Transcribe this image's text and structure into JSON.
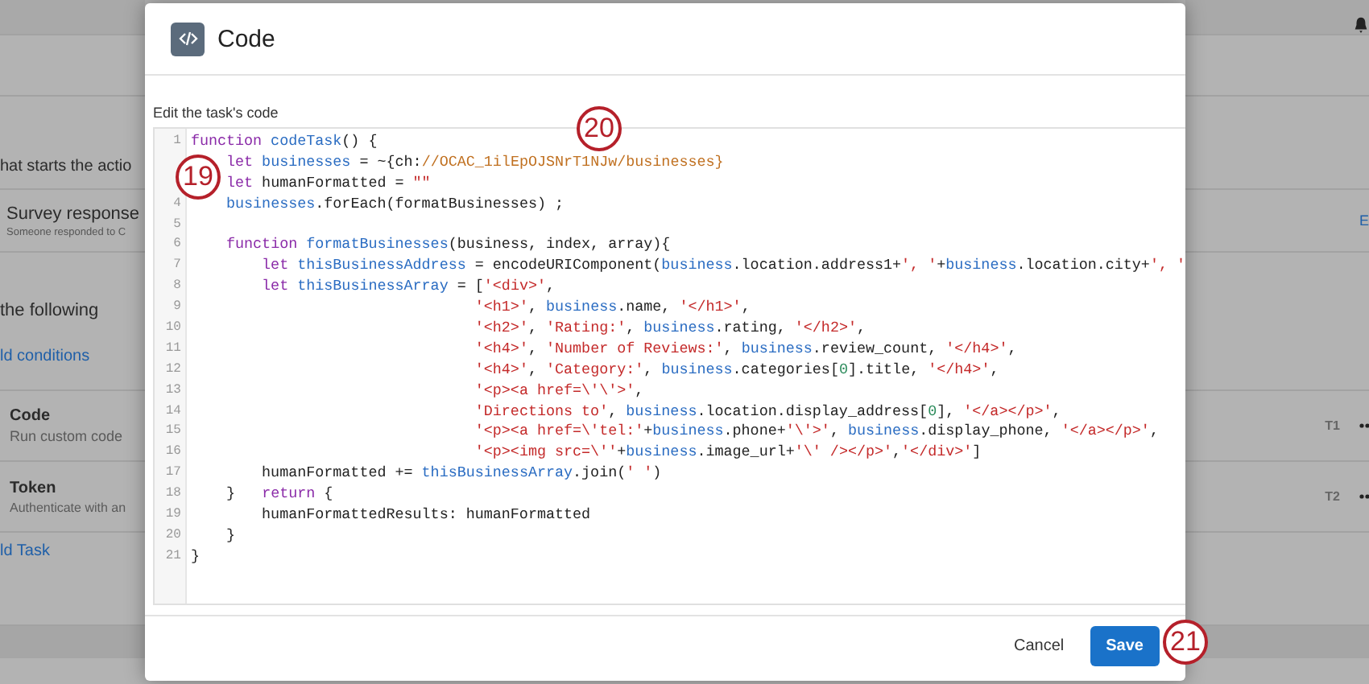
{
  "background": {
    "trigger_heading": "hat starts the actio",
    "trigger": {
      "title": "Survey response",
      "subtitle": "Someone responded to C",
      "link": "E"
    },
    "conditions_heading": "the following",
    "conditions_link": "ld conditions",
    "tasks": [
      {
        "title": "Code",
        "subtitle": "Run custom code",
        "tag": "T1"
      },
      {
        "title": "Token",
        "subtitle": "Authenticate with an",
        "tag": "T2"
      }
    ],
    "add_task_link": "ld Task"
  },
  "dialog": {
    "title": "Code",
    "field_label": "Edit the task's code",
    "lines": [
      {
        "n": "1",
        "segs": [
          {
            "kind": "kw",
            "text": "function"
          },
          {
            "kind": "def",
            "text": " codeTask"
          },
          {
            "kind": "p",
            "text": "() {"
          }
        ]
      },
      {
        "segs": [
          {
            "kind": "kw",
            "text": "    let"
          },
          {
            "kind": "def",
            "text": " businesses"
          },
          {
            "kind": "p",
            "text": " = ~{ch:"
          },
          {
            "kind": "pipe",
            "text": "//OCAC_1ilEpOJSNrT1NJw/businesses}"
          }
        ]
      },
      {
        "segs": [
          {
            "kind": "kw",
            "text": "    let"
          },
          {
            "kind": "p",
            "text": " humanFormatted = "
          },
          {
            "kind": "str",
            "text": "\"\""
          }
        ]
      },
      {
        "n": "4",
        "segs": [
          {
            "kind": "def",
            "text": "    businesses"
          },
          {
            "kind": "p",
            "text": ".forEach(formatBusinesses) ;"
          }
        ]
      },
      {
        "n": "5"
      },
      {
        "n": "6",
        "segs": [
          {
            "kind": "kw",
            "text": "    function"
          },
          {
            "kind": "def",
            "text": " formatBusinesses"
          },
          {
            "kind": "p",
            "text": "(business, index, array){"
          }
        ]
      },
      {
        "n": "7",
        "segs": [
          {
            "kind": "kw",
            "text": "        let"
          },
          {
            "kind": "def",
            "text": " thisBusinessAddress"
          },
          {
            "kind": "p",
            "text": " = encodeURIComponent("
          },
          {
            "kind": "def",
            "text": "business"
          },
          {
            "kind": "p",
            "text": ".location.address1+"
          },
          {
            "kind": "str",
            "text": "', '"
          },
          {
            "kind": "p",
            "text": "+"
          },
          {
            "kind": "def",
            "text": "business"
          },
          {
            "kind": "p",
            "text": ".location.city+"
          },
          {
            "kind": "str",
            "text": "', '"
          }
        ]
      },
      {
        "n": "8",
        "segs": [
          {
            "kind": "kw",
            "text": "        let"
          },
          {
            "kind": "def",
            "text": " thisBusinessArray"
          },
          {
            "kind": "p",
            "text": " = ["
          },
          {
            "kind": "str",
            "text": "'<div>'"
          },
          {
            "kind": "p",
            "text": ","
          }
        ]
      },
      {
        "n": "9",
        "segs": [
          {
            "kind": "str",
            "text": "                                '<h1>'"
          },
          {
            "kind": "p",
            "text": ", "
          },
          {
            "kind": "def",
            "text": "business"
          },
          {
            "kind": "p",
            "text": ".name, "
          },
          {
            "kind": "str",
            "text": "'</h1>'"
          },
          {
            "kind": "p",
            "text": ","
          }
        ]
      },
      {
        "n": "10",
        "segs": [
          {
            "kind": "str",
            "text": "                                '<h2>'"
          },
          {
            "kind": "p",
            "text": ", "
          },
          {
            "kind": "str",
            "text": "'Rating:'"
          },
          {
            "kind": "p",
            "text": ", "
          },
          {
            "kind": "def",
            "text": "business"
          },
          {
            "kind": "p",
            "text": ".rating, "
          },
          {
            "kind": "str",
            "text": "'</h2>'"
          },
          {
            "kind": "p",
            "text": ","
          }
        ]
      },
      {
        "n": "11",
        "segs": [
          {
            "kind": "str",
            "text": "                                '<h4>'"
          },
          {
            "kind": "p",
            "text": ", "
          },
          {
            "kind": "str",
            "text": "'Number of Reviews:'"
          },
          {
            "kind": "p",
            "text": ", "
          },
          {
            "kind": "def",
            "text": "business"
          },
          {
            "kind": "p",
            "text": ".review_count, "
          },
          {
            "kind": "str",
            "text": "'</h4>'"
          },
          {
            "kind": "p",
            "text": ","
          }
        ]
      },
      {
        "n": "12",
        "segs": [
          {
            "kind": "str",
            "text": "                                '<h4>'"
          },
          {
            "kind": "p",
            "text": ", "
          },
          {
            "kind": "str",
            "text": "'Category:'"
          },
          {
            "kind": "p",
            "text": ", "
          },
          {
            "kind": "def",
            "text": "business"
          },
          {
            "kind": "p",
            "text": ".categories["
          },
          {
            "kind": "num",
            "text": "0"
          },
          {
            "kind": "p",
            "text": "].title, "
          },
          {
            "kind": "str",
            "text": "'</h4>'"
          },
          {
            "kind": "p",
            "text": ","
          }
        ]
      },
      {
        "n": "13",
        "segs": [
          {
            "kind": "str",
            "text": "                                '<p><a href=\\'\\'>'"
          },
          {
            "kind": "p",
            "text": ","
          }
        ]
      },
      {
        "n": "14",
        "segs": [
          {
            "kind": "str",
            "text": "                                'Directions to'"
          },
          {
            "kind": "p",
            "text": ", "
          },
          {
            "kind": "def",
            "text": "business"
          },
          {
            "kind": "p",
            "text": ".location.display_address["
          },
          {
            "kind": "num",
            "text": "0"
          },
          {
            "kind": "p",
            "text": "], "
          },
          {
            "kind": "str",
            "text": "'</a></p>'"
          },
          {
            "kind": "p",
            "text": ","
          }
        ]
      },
      {
        "n": "15",
        "segs": [
          {
            "kind": "str",
            "text": "                                '<p><a href=\\'tel:'"
          },
          {
            "kind": "p",
            "text": "+"
          },
          {
            "kind": "def",
            "text": "business"
          },
          {
            "kind": "p",
            "text": ".phone+"
          },
          {
            "kind": "str",
            "text": "'\\'>'"
          },
          {
            "kind": "p",
            "text": ", "
          },
          {
            "kind": "def",
            "text": "business"
          },
          {
            "kind": "p",
            "text": ".display_phone, "
          },
          {
            "kind": "str",
            "text": "'</a></p>'"
          },
          {
            "kind": "p",
            "text": ","
          }
        ]
      },
      {
        "n": "16",
        "segs": [
          {
            "kind": "str",
            "text": "                                '<p><img src=\\''"
          },
          {
            "kind": "p",
            "text": "+"
          },
          {
            "kind": "def",
            "text": "business"
          },
          {
            "kind": "p",
            "text": ".image_url+"
          },
          {
            "kind": "str",
            "text": "'\\' /></p>'"
          },
          {
            "kind": "p",
            "text": ","
          },
          {
            "kind": "str",
            "text": "'</div>'"
          },
          {
            "kind": "p",
            "text": "]"
          }
        ]
      },
      {
        "n": "17",
        "segs": [
          {
            "kind": "p",
            "text": "        humanFormatted += "
          },
          {
            "kind": "def",
            "text": "thisBusinessArray"
          },
          {
            "kind": "p",
            "text": ".join("
          },
          {
            "kind": "str",
            "text": "' '"
          },
          {
            "kind": "p",
            "text": ")"
          }
        ]
      },
      {
        "n": "18",
        "segs": [
          {
            "kind": "p",
            "text": "    }   "
          },
          {
            "kind": "kw",
            "text": "return"
          },
          {
            "kind": "p",
            "text": " {"
          }
        ]
      },
      {
        "n": "19",
        "segs": [
          {
            "kind": "p",
            "text": "        humanFormattedResults: humanFormatted"
          }
        ]
      },
      {
        "n": "20",
        "segs": [
          {
            "kind": "p",
            "text": "    }"
          }
        ]
      },
      {
        "n": "21",
        "segs": [
          {
            "kind": "p",
            "text": "}"
          }
        ]
      }
    ],
    "buttons": [
      {
        "label": "Cancel",
        "kind": "link"
      },
      {
        "label": "Save",
        "kind": "primary"
      }
    ]
  },
  "callouts": [
    {
      "number": "19",
      "kind": "editor"
    },
    {
      "number": "20",
      "kind": "code"
    },
    {
      "number": "21",
      "kind": "save"
    }
  ]
}
